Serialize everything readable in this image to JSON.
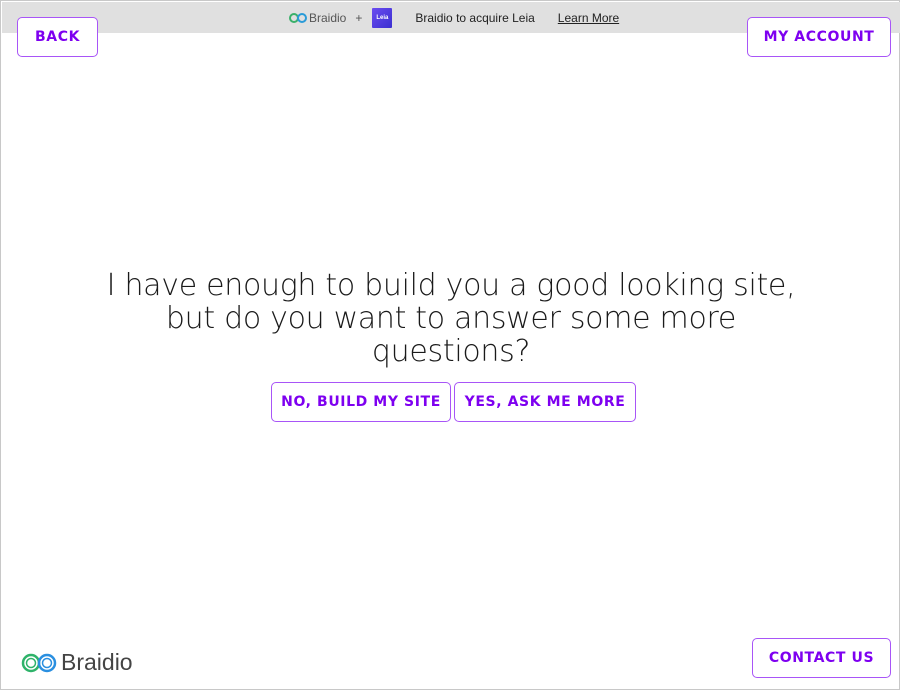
{
  "banner": {
    "brand": "Braidio",
    "plus": "+",
    "partner_logo": "Leia",
    "message": "Braidio to acquire Leia",
    "link": "Learn More"
  },
  "header": {
    "back_label": "BACK",
    "account_label": "MY ACCOUNT"
  },
  "main": {
    "question": "I have enough to build you a good looking site, but do you want to answer some more questions?",
    "no_label": "NO, BUILD MY SITE",
    "yes_label": "YES, ASK ME MORE"
  },
  "footer": {
    "brand": "Braidio",
    "contact_label": "CONTACT US"
  },
  "colors": {
    "accent": "#7e00f0",
    "border": "#a855f7",
    "banner_bg": "#e0e0e0"
  }
}
